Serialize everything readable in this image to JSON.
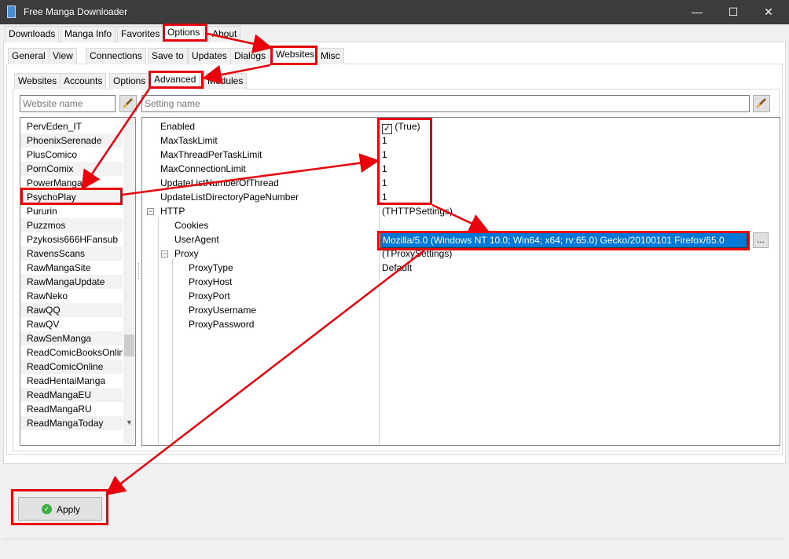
{
  "window": {
    "title": "Free Manga Downloader",
    "minimize": "—",
    "maximize": "☐",
    "close": "✕"
  },
  "main_tabs": [
    "Downloads",
    "Manga Info",
    "Favorites",
    "Options",
    "About"
  ],
  "options_tabs": [
    "General",
    "View",
    "Connections",
    "Save to",
    "Updates",
    "Dialogs",
    "Websites",
    "Misc"
  ],
  "websites_tabs": [
    "Websites",
    "Accounts",
    "Options",
    "Advanced",
    "Modules"
  ],
  "website_filter": {
    "placeholder": "Website name"
  },
  "setting_filter": {
    "placeholder": "Setting name"
  },
  "website_list": [
    "PervEden_IT",
    "PhoenixSerenade",
    "PlusComico",
    "PornComix",
    "PowerManga",
    "PsychoPlay",
    "Pururin",
    "Puzzmos",
    "Pzykosis666HFansub",
    "RavensScans",
    "RawMangaSite",
    "RawMangaUpdate",
    "RawNeko",
    "RawQQ",
    "RawQV",
    "RawSenManga",
    "ReadComicBooksOnline",
    "ReadComicOnline",
    "ReadHentaiManga",
    "ReadMangaEU",
    "ReadMangaRU",
    "ReadMangaToday"
  ],
  "settings": {
    "enabled": {
      "name": "Enabled",
      "value": "(True)"
    },
    "max_task": {
      "name": "MaxTaskLimit",
      "value": "1"
    },
    "max_thread": {
      "name": "MaxThreadPerTaskLimit",
      "value": "1"
    },
    "max_conn": {
      "name": "MaxConnectionLimit",
      "value": "1"
    },
    "update_thread": {
      "name": "UpdateListNumberOfThread",
      "value": "1"
    },
    "update_dir": {
      "name": "UpdateListDirectoryPageNumber",
      "value": "1"
    },
    "http": {
      "name": "HTTP",
      "value": "(THTTPSettings)"
    },
    "cookies": {
      "name": "Cookies",
      "value": ""
    },
    "useragent": {
      "name": "UserAgent",
      "value": "Mozilla/5.0 (Windows NT 10.0; Win64; x64; rv:65.0) Gecko/20100101 Firefox/65.0"
    },
    "proxy": {
      "name": "Proxy",
      "value": "(TProxySettings)"
    },
    "proxy_type": {
      "name": "ProxyType",
      "value": "Default"
    },
    "proxy_host": {
      "name": "ProxyHost",
      "value": ""
    },
    "proxy_port": {
      "name": "ProxyPort",
      "value": ""
    },
    "proxy_user": {
      "name": "ProxyUsername",
      "value": ""
    },
    "proxy_pass": {
      "name": "ProxyPassword",
      "value": ""
    }
  },
  "expander_minus": "−",
  "ellipsis": "...",
  "checkmark": "✓",
  "apply_label": "Apply",
  "apply_icon": "✓",
  "scroll_up": "▲",
  "scroll_down": "▼",
  "colors": {
    "annotation": "#e8000b",
    "selection": "#0078d7",
    "titlebar": "#3c3c3c"
  },
  "icons": {
    "app": "book-icon",
    "clear": "broom-icon",
    "ok": "check-circle-icon"
  }
}
